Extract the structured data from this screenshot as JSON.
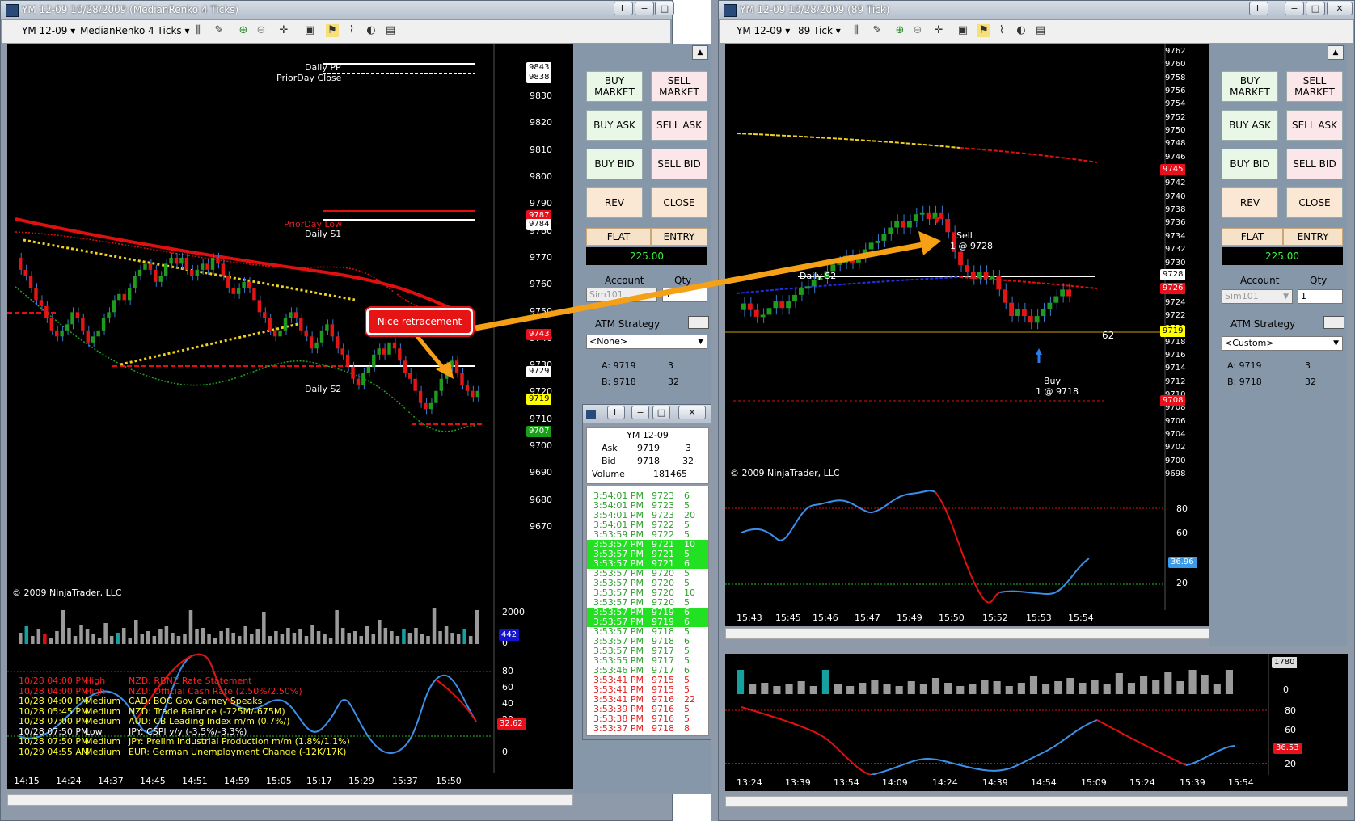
{
  "left_window": {
    "title": "YM 12-09  10/28/2009 (MedianRenko 4 Ticks)",
    "instrument": "YM 12-09",
    "bar_type": "MedianRenko 4 Ticks",
    "copyright": "© 2009 NinjaTrader, LLC",
    "price_axis": [
      "9830",
      "9820",
      "9810",
      "9800",
      "9790",
      "9780",
      "9770",
      "9760",
      "9750",
      "9740",
      "9730",
      "9720",
      "9710",
      "9700",
      "9690",
      "9680",
      "9670"
    ],
    "price_markers": [
      {
        "label": "9843",
        "bg": "#ffffff",
        "fg": "#000000"
      },
      {
        "label": "9838",
        "bg": "#ffffff",
        "fg": "#000000"
      },
      {
        "label": "9787",
        "bg": "#e8101a",
        "fg": "#ffffff"
      },
      {
        "label": "9784",
        "bg": "#ffffff",
        "fg": "#000000"
      },
      {
        "label": "9743",
        "bg": "#e8101a",
        "fg": "#ffffff"
      },
      {
        "label": "9729",
        "bg": "#ffffff",
        "fg": "#000000"
      },
      {
        "label": "9719",
        "bg": "#ffff00",
        "fg": "#000000"
      },
      {
        "label": "9707",
        "bg": "#18a018",
        "fg": "#ffffff"
      }
    ],
    "levels": {
      "daily_pp": "Daily PP",
      "priorday_close": "PriorDay Close",
      "priorday_low": "PriorDay Low",
      "daily_s1": "Daily S1",
      "daily_s2": "Daily S2"
    },
    "annotation": "Nice retracement",
    "volume_axis": [
      "2000",
      "0"
    ],
    "volume_marker": "442",
    "osc_axis": [
      "80",
      "60",
      "40",
      "20",
      "0"
    ],
    "osc_marker": "32.62",
    "time_axis": [
      "14:15",
      "14:24",
      "14:37",
      "14:45",
      "14:51",
      "14:59",
      "15:05",
      "15:17",
      "15:29",
      "15:37",
      "15:50"
    ],
    "news": [
      {
        "time": "10/28 04:00 PM",
        "impact": "High",
        "text": "NZD: RBNZ Rate Statement",
        "color": "#ff2020"
      },
      {
        "time": "10/28 04:00 PM",
        "impact": "High",
        "text": "NZD: Official Cash Rate (2.50%/2.50%)",
        "color": "#ff2020"
      },
      {
        "time": "10/28 04:00 PM",
        "impact": "Medium",
        "text": "CAD: BOC Gov Carney Speaks",
        "color": "#ffff30"
      },
      {
        "time": "10/28 05:45 PM",
        "impact": "Medium",
        "text": "NZD: Trade Balance (-725M/-675M)",
        "color": "#ffff30"
      },
      {
        "time": "10/28 07:00 PM",
        "impact": "Medium",
        "text": "AUD: CB Leading Index m/m (0.7%/)",
        "color": "#ffff30"
      },
      {
        "time": "10/28 07:50 PM",
        "impact": "Low",
        "text": "JPY: CSPI y/y (-3.5%/-3.3%)",
        "color": "#ffffff"
      },
      {
        "time": "10/28 07:50 PM",
        "impact": "Medium",
        "text": "JPY: Prelim Industrial Production m/m (1.8%/1.1%)",
        "color": "#ffff30"
      },
      {
        "time": "10/29 04:55 AM",
        "impact": "Medium",
        "text": "EUR: German Unemployment Change (-12K/17K)",
        "color": "#ffff30"
      }
    ]
  },
  "order_panel_left": {
    "buy_market": "BUY MARKET",
    "sell_market": "SELL MARKET",
    "buy_ask": "BUY ASK",
    "sell_ask": "SELL ASK",
    "buy_bid": "BUY BID",
    "sell_bid": "SELL BID",
    "rev": "REV",
    "close": "CLOSE",
    "flat": "FLAT",
    "entry": "ENTRY",
    "pnl": "225.00",
    "account_label": "Account",
    "qty_label": "Qty",
    "account": "Sim101",
    "qty": "1",
    "atm_label": "ATM Strategy",
    "atm_value": "<None>",
    "ask": "A: 9719",
    "ask_size": "3",
    "bid": "B: 9718",
    "bid_size": "32"
  },
  "time_sales": {
    "title_l": "L",
    "instrument": "YM 12-09",
    "ask_label": "Ask",
    "ask": "9719",
    "ask_size": "3",
    "bid_label": "Bid",
    "bid": "9718",
    "bid_size": "32",
    "volume_label": "Volume",
    "volume": "181465",
    "rows": [
      {
        "t": "3:54:01 PM",
        "p": "9723",
        "s": "6",
        "c": "#2ca02c",
        "bg": ""
      },
      {
        "t": "3:54:01 PM",
        "p": "9723",
        "s": "5",
        "c": "#2ca02c",
        "bg": ""
      },
      {
        "t": "3:54:01 PM",
        "p": "9723",
        "s": "20",
        "c": "#2ca02c",
        "bg": ""
      },
      {
        "t": "3:54:01 PM",
        "p": "9722",
        "s": "5",
        "c": "#2ca02c",
        "bg": ""
      },
      {
        "t": "3:53:59 PM",
        "p": "9722",
        "s": "5",
        "c": "#2ca02c",
        "bg": ""
      },
      {
        "t": "3:53:57 PM",
        "p": "9721",
        "s": "10",
        "c": "#ffffff",
        "bg": "#22e022"
      },
      {
        "t": "3:53:57 PM",
        "p": "9721",
        "s": "5",
        "c": "#ffffff",
        "bg": "#22e022"
      },
      {
        "t": "3:53:57 PM",
        "p": "9721",
        "s": "6",
        "c": "#ffffff",
        "bg": "#22e022"
      },
      {
        "t": "3:53:57 PM",
        "p": "9720",
        "s": "5",
        "c": "#2ca02c",
        "bg": ""
      },
      {
        "t": "3:53:57 PM",
        "p": "9720",
        "s": "5",
        "c": "#2ca02c",
        "bg": ""
      },
      {
        "t": "3:53:57 PM",
        "p": "9720",
        "s": "10",
        "c": "#2ca02c",
        "bg": ""
      },
      {
        "t": "3:53:57 PM",
        "p": "9720",
        "s": "5",
        "c": "#2ca02c",
        "bg": ""
      },
      {
        "t": "3:53:57 PM",
        "p": "9719",
        "s": "6",
        "c": "#ffffff",
        "bg": "#22e022"
      },
      {
        "t": "3:53:57 PM",
        "p": "9719",
        "s": "6",
        "c": "#ffffff",
        "bg": "#22e022"
      },
      {
        "t": "3:53:57 PM",
        "p": "9718",
        "s": "5",
        "c": "#2ca02c",
        "bg": ""
      },
      {
        "t": "3:53:57 PM",
        "p": "9718",
        "s": "6",
        "c": "#2ca02c",
        "bg": ""
      },
      {
        "t": "3:53:57 PM",
        "p": "9717",
        "s": "5",
        "c": "#2ca02c",
        "bg": ""
      },
      {
        "t": "3:53:55 PM",
        "p": "9717",
        "s": "5",
        "c": "#2ca02c",
        "bg": ""
      },
      {
        "t": "3:53:46 PM",
        "p": "9717",
        "s": "6",
        "c": "#2ca02c",
        "bg": ""
      },
      {
        "t": "3:53:41 PM",
        "p": "9715",
        "s": "5",
        "c": "#e02020",
        "bg": ""
      },
      {
        "t": "3:53:41 PM",
        "p": "9715",
        "s": "5",
        "c": "#e02020",
        "bg": ""
      },
      {
        "t": "3:53:41 PM",
        "p": "9716",
        "s": "22",
        "c": "#e02020",
        "bg": ""
      },
      {
        "t": "3:53:39 PM",
        "p": "9716",
        "s": "5",
        "c": "#e02020",
        "bg": ""
      },
      {
        "t": "3:53:38 PM",
        "p": "9716",
        "s": "5",
        "c": "#e02020",
        "bg": ""
      },
      {
        "t": "3:53:37 PM",
        "p": "9718",
        "s": "8",
        "c": "#e02020",
        "bg": ""
      }
    ]
  },
  "right_window": {
    "title": "YM 12-09  10/28/2009 (89 Tick)",
    "instrument": "YM 12-09",
    "bar_type": "89 Tick",
    "copyright": "© 2009 NinjaTrader, LLC",
    "price_axis": [
      "9762",
      "9760",
      "9758",
      "9756",
      "9754",
      "9752",
      "9750",
      "9748",
      "9746",
      "9744",
      "9742",
      "9740",
      "9738",
      "9736",
      "9734",
      "9732",
      "9730",
      "9728",
      "9726",
      "9724",
      "9722",
      "9720",
      "9718",
      "9716",
      "9714",
      "9712",
      "9710",
      "9708",
      "9706",
      "9704",
      "9702",
      "9700",
      "9698"
    ],
    "price_markers": [
      {
        "label": "9745",
        "bg": "#e8101a",
        "fg": "#ffffff"
      },
      {
        "label": "9728",
        "bg": "#ffffff",
        "fg": "#000000"
      },
      {
        "label": "9726",
        "bg": "#e8101a",
        "fg": "#ffffff"
      },
      {
        "label": "9719",
        "bg": "#ffff00",
        "fg": "#000000"
      },
      {
        "label": "9708",
        "bg": "#e8101a",
        "fg": "#ffffff"
      }
    ],
    "daily_s2": "Daily S2",
    "sell_label": "Sell",
    "sell_fill": "1 @ 9728",
    "buy_label": "Buy",
    "buy_fill": "1 @ 9718",
    "ticks_remaining": "62",
    "osc_axis": [
      "80",
      "60",
      "20"
    ],
    "osc_marker": "36.96",
    "time_axis": [
      "15:43",
      "15:45",
      "15:46",
      "15:47",
      "15:49",
      "15:50",
      "15:52",
      "15:53",
      "15:54"
    ],
    "lower_volume_axis": [
      "1780",
      "0"
    ],
    "lower_osc_axis": [
      "80",
      "60",
      "40",
      "20"
    ],
    "lower_osc_marker": "36.53",
    "lower_time_axis": [
      "13:24",
      "13:39",
      "13:54",
      "14:09",
      "14:24",
      "14:39",
      "14:54",
      "15:09",
      "15:24",
      "15:39",
      "15:54"
    ]
  },
  "order_panel_right": {
    "buy_market": "BUY MARKET",
    "sell_market": "SELL MARKET",
    "buy_ask": "BUY ASK",
    "sell_ask": "SELL ASK",
    "buy_bid": "BUY BID",
    "sell_bid": "SELL BID",
    "rev": "REV",
    "close": "CLOSE",
    "flat": "FLAT",
    "entry": "ENTRY",
    "pnl": "225.00",
    "account_label": "Account",
    "qty_label": "Qty",
    "account": "Sim101",
    "qty": "1",
    "atm_label": "ATM Strategy",
    "atm_value": "<Custom>",
    "ask": "A: 9719",
    "ask_size": "3",
    "bid": "B: 9718",
    "bid_size": "32"
  },
  "window_buttons": {
    "link": "L",
    "min": "−",
    "max": "□",
    "close": "✕"
  },
  "colors": {
    "buy_bg": "#e9f8e6",
    "sell_bg": "#fbe7ea",
    "rev_bg": "#fae8d4",
    "panel": "#8797aa",
    "pnl_text": "#3cf03c"
  }
}
